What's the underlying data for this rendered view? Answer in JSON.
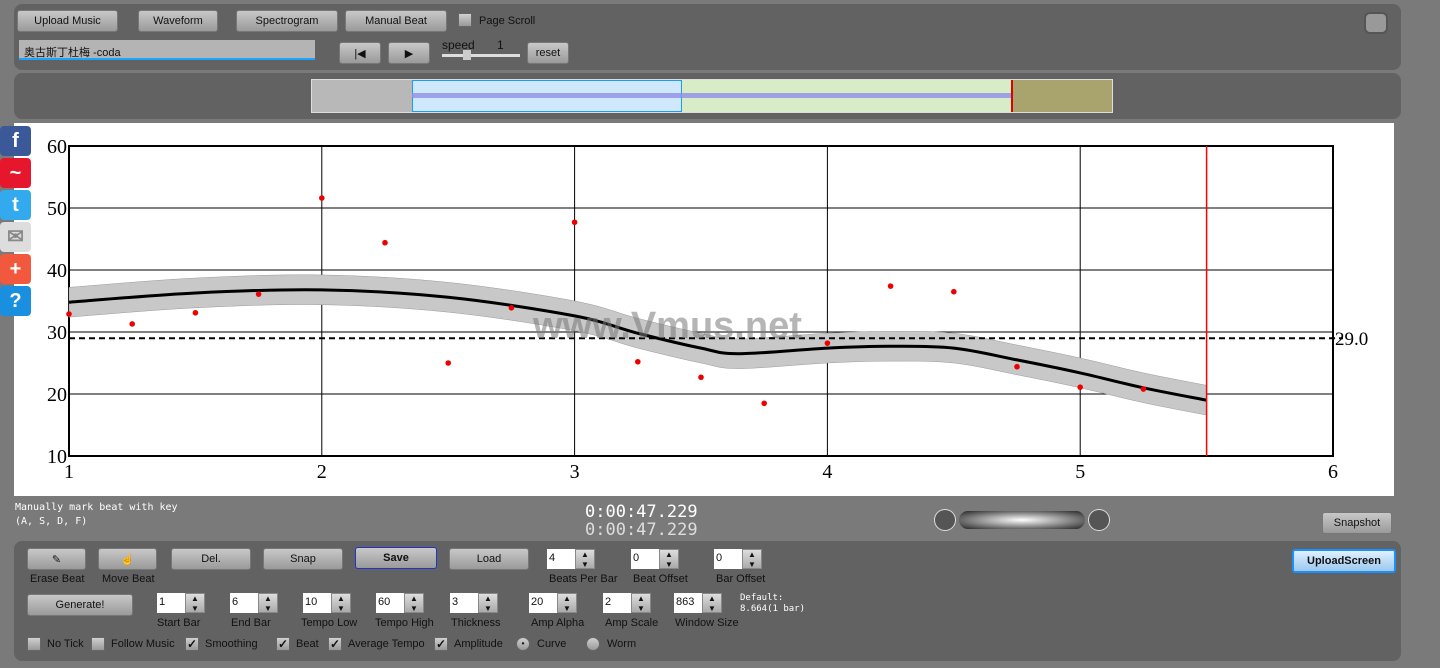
{
  "toolbar": {
    "upload": "Upload Music",
    "waveform": "Waveform",
    "spectrogram": "Spectrogram",
    "manual_beat": "Manual Beat",
    "page_scroll": "Page Scroll",
    "title_value": "奥古斯丁杜梅 -coda",
    "speed_label": "speed",
    "speed_value": "1",
    "reset": "reset"
  },
  "hint": {
    "line1": "Manually mark beat with key",
    "line2": "(A, S, D, F)"
  },
  "time": {
    "current": "0:00:47.229",
    "total": "0:00:47.229"
  },
  "snapshot": "Snapshot",
  "upload_screen": "UploadScreen",
  "controls": {
    "erase": "Erase Beat",
    "move": "Move Beat",
    "del": "Del.",
    "snap": "Snap",
    "save": "Save",
    "load": "Load",
    "generate": "Generate!",
    "beats_per_bar": {
      "label": "Beats Per Bar",
      "value": "4"
    },
    "beat_offset": {
      "label": "Beat Offset",
      "value": "0"
    },
    "bar_offset": {
      "label": "Bar Offset",
      "value": "0"
    },
    "start_bar": {
      "label": "Start Bar",
      "value": "1"
    },
    "end_bar": {
      "label": "End Bar",
      "value": "6"
    },
    "tempo_low": {
      "label": "Tempo Low",
      "value": "10"
    },
    "tempo_high": {
      "label": "Tempo High",
      "value": "60"
    },
    "thickness": {
      "label": "Thickness",
      "value": "3"
    },
    "amp_alpha": {
      "label": "Amp Alpha",
      "value": "20"
    },
    "amp_scale": {
      "label": "Amp Scale",
      "value": "2"
    },
    "window_size": {
      "label": "Window Size",
      "value": "863"
    },
    "default1": "Default:",
    "default2": "8.664(1 bar)",
    "no_tick": "No Tick",
    "follow_music": "Follow Music",
    "smoothing": "Smoothing",
    "beat": "Beat",
    "average_tempo": "Average Tempo",
    "amplitude": "Amplitude",
    "curve": "Curve",
    "worm": "Worm",
    "check": "✓"
  },
  "social": [
    "f",
    "~",
    "t",
    "✉",
    "+",
    "?"
  ],
  "watermark": "www.Vmus.net",
  "chart_data": {
    "type": "scatter+line",
    "xlim": [
      1,
      6
    ],
    "ylim": [
      10,
      60
    ],
    "xticks": [
      "1",
      "2",
      "3",
      "4",
      "5",
      "6"
    ],
    "yticks": [
      "10",
      "20",
      "30",
      "40",
      "50",
      "60"
    ],
    "grid": true,
    "average": {
      "value": 29.0,
      "label": "29.0"
    },
    "cursor_x": 5.5,
    "beats": [
      [
        1,
        32.9
      ],
      [
        1.25,
        31.3
      ],
      [
        1.5,
        33.1
      ],
      [
        1.75,
        36.1
      ],
      [
        2,
        51.6
      ],
      [
        2.25,
        44.4
      ],
      [
        2.5,
        25.0
      ],
      [
        2.75,
        33.9
      ],
      [
        3,
        47.7
      ],
      [
        3.25,
        25.2
      ],
      [
        3.5,
        22.7
      ],
      [
        3.75,
        18.5
      ],
      [
        4,
        28.2
      ],
      [
        4.25,
        37.4
      ],
      [
        4.5,
        36.5
      ],
      [
        4.75,
        24.4
      ],
      [
        5,
        21.1
      ],
      [
        5.25,
        20.8
      ]
    ],
    "curve": [
      [
        1,
        34.8
      ],
      [
        1.5,
        36.3
      ],
      [
        2,
        36.8
      ],
      [
        2.5,
        35.6
      ],
      [
        3,
        32.6
      ],
      [
        3.25,
        29.8
      ],
      [
        3.5,
        27.4
      ],
      [
        3.65,
        26.5
      ],
      [
        4,
        27.4
      ],
      [
        4.25,
        27.7
      ],
      [
        4.5,
        27.4
      ],
      [
        4.75,
        25.5
      ],
      [
        5,
        23.4
      ],
      [
        5.25,
        21.0
      ],
      [
        5.5,
        19.0
      ]
    ],
    "band_halfwidth": 2.4,
    "colors": {
      "beat": "#ee0000",
      "curve": "#000000",
      "band": "#c8c8c8",
      "cursor": "#ff0000"
    }
  }
}
